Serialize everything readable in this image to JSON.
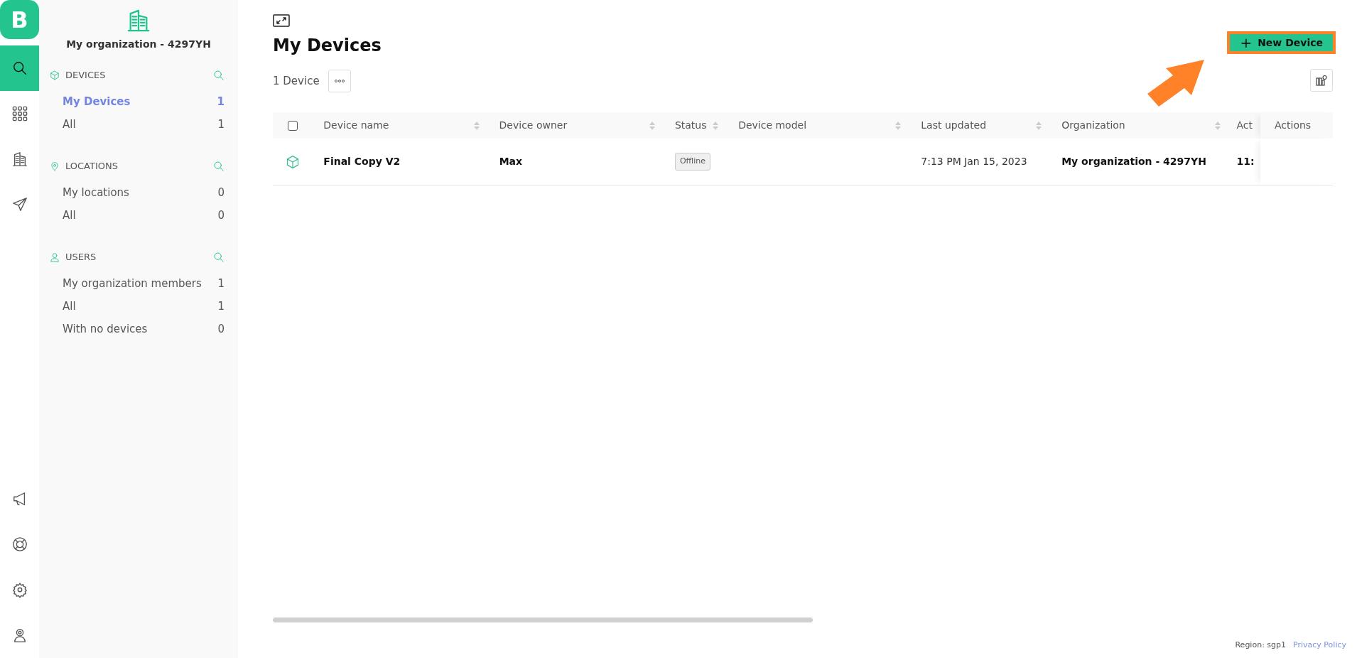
{
  "logo": {
    "letter": "B"
  },
  "rail": {
    "top_items": [
      {
        "kind": "search",
        "selected": true
      },
      {
        "kind": "grid",
        "selected": false
      },
      {
        "kind": "building",
        "selected": false
      },
      {
        "kind": "send",
        "selected": false
      }
    ],
    "bottom_items": [
      {
        "kind": "megaphone"
      },
      {
        "kind": "lifebuoy"
      },
      {
        "kind": "settings"
      },
      {
        "kind": "user"
      }
    ]
  },
  "sidebar": {
    "organization": "My organization - 4297YH",
    "sections": [
      {
        "kind": "devices",
        "title": "DEVICES",
        "items": [
          {
            "label": "My Devices",
            "count": "1",
            "selected": true
          },
          {
            "label": "All",
            "count": "1",
            "selected": false
          }
        ]
      },
      {
        "kind": "locations",
        "title": "LOCATIONS",
        "items": [
          {
            "label": "My locations",
            "count": "0",
            "selected": false
          },
          {
            "label": "All",
            "count": "0",
            "selected": false
          }
        ]
      },
      {
        "kind": "users",
        "title": "USERS",
        "items": [
          {
            "label": "My organization members",
            "count": "1",
            "selected": false
          },
          {
            "label": "All",
            "count": "1",
            "selected": false
          },
          {
            "label": "With no devices",
            "count": "0",
            "selected": false
          }
        ]
      }
    ]
  },
  "main": {
    "title": "My Devices",
    "count": "1 Device",
    "new_button": "New Device",
    "new_button_icon": "+"
  },
  "table": {
    "select_all_checked": false,
    "columns": [
      {
        "label": "Device name",
        "sortable": true
      },
      {
        "label": "Device owner",
        "sortable": true
      },
      {
        "label": "Status",
        "sortable": true
      },
      {
        "label": "Device model",
        "sortable": true
      },
      {
        "label": "Last updated",
        "sortable": true
      },
      {
        "label": "Organization",
        "sortable": true
      },
      {
        "label": "Act",
        "sortable": false
      },
      {
        "label": "Actions",
        "sortable": false
      }
    ],
    "rows": [
      {
        "checked": false,
        "cells": [
          "Final Copy V2",
          "Max",
          "Offline",
          "",
          "7:13 PM Jan 15, 2023",
          "My organization - 4297YH",
          "11:",
          ""
        ]
      }
    ]
  },
  "footer": {
    "region": "Region: sgp1",
    "privacy": "Privacy Policy"
  }
}
